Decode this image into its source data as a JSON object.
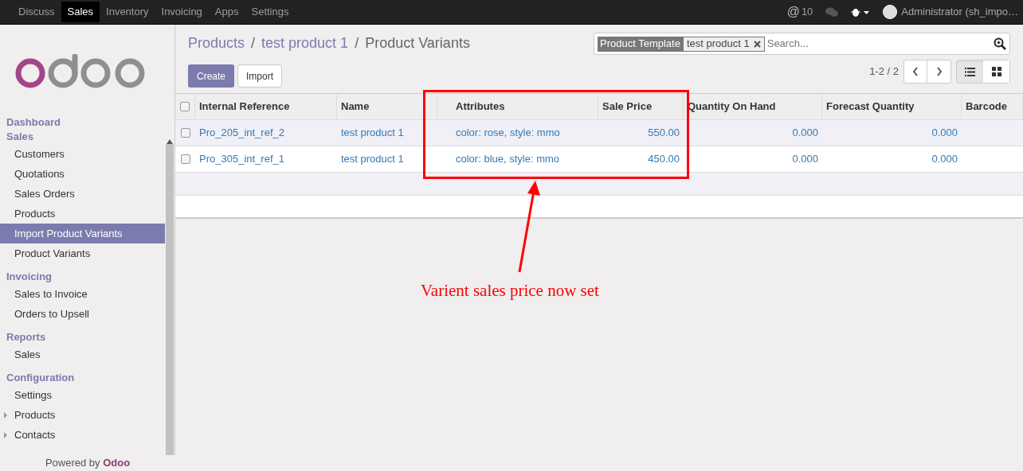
{
  "top_menu": [
    {
      "label": "Discuss",
      "selected": false
    },
    {
      "label": "Sales",
      "selected": true
    },
    {
      "label": "Inventory",
      "selected": false
    },
    {
      "label": "Invoicing",
      "selected": false
    },
    {
      "label": "Apps",
      "selected": false
    },
    {
      "label": "Settings",
      "selected": false
    }
  ],
  "systray": {
    "mention_icon": "@",
    "mentions": "10",
    "user": "Administrator (sh_impo…"
  },
  "sidebar": {
    "sections": [
      {
        "title": "Dashboard"
      },
      {
        "title": "Sales",
        "items": [
          {
            "label": "Customers",
            "selected": false
          },
          {
            "label": "Quotations",
            "selected": false
          },
          {
            "label": "Sales Orders",
            "selected": false
          },
          {
            "label": "Products",
            "selected": false
          },
          {
            "label": "Import Product Variants",
            "selected": true
          },
          {
            "label": "Product Variants",
            "selected": false
          }
        ]
      },
      {
        "title": "Invoicing",
        "items": [
          {
            "label": "Sales to Invoice",
            "selected": false
          },
          {
            "label": "Orders to Upsell",
            "selected": false
          }
        ]
      },
      {
        "title": "Reports",
        "items": [
          {
            "label": "Sales",
            "selected": false
          }
        ]
      },
      {
        "title": "Configuration",
        "items": [
          {
            "label": "Settings",
            "selected": false,
            "expandable": false
          },
          {
            "label": "Products",
            "selected": false,
            "expandable": true
          },
          {
            "label": "Contacts",
            "selected": false,
            "expandable": true
          }
        ]
      }
    ],
    "footer": "Powered by **Odoo**"
  },
  "breadcrumbs": [
    "Products",
    "test product 1",
    "Product Variants"
  ],
  "breadcrumb_separator": "/",
  "buttons": {
    "create": "Create",
    "import": "Import"
  },
  "search": {
    "facet_label": "Product Template",
    "facet_value": "test product 1",
    "placeholder": "Search..."
  },
  "pager": "1-2 / 2",
  "view_switcher": [
    {
      "kind": "list",
      "selected": true
    },
    {
      "kind": "kanban",
      "selected": false
    }
  ],
  "table": {
    "all_checked": false,
    "columns": [
      "Internal Reference",
      "Name",
      "Attributes",
      "Sale Price",
      "Quantity On Hand",
      "Forecast Quantity",
      "Barcode"
    ],
    "rows": [
      {
        "checked": false,
        "cells": [
          "Pro_205_int_ref_2",
          "test product 1",
          "color: rose, style: mmo",
          "550.00",
          "0.000",
          "0.000",
          ""
        ]
      },
      {
        "checked": false,
        "cells": [
          "Pro_305_int_ref_1",
          "test product 1",
          "color: blue, style: mmo",
          "450.00",
          "0.000",
          "0.000",
          ""
        ]
      }
    ]
  },
  "annotation": "Varient sales price now set"
}
